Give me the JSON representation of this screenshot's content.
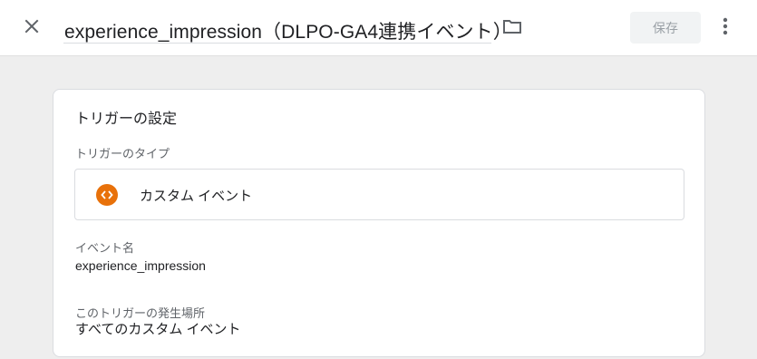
{
  "header": {
    "title": "experience_impression（DLPO-GA4連携イベント）",
    "save_label": "保存",
    "close_icon": "close-icon",
    "folder_icon": "folder-icon",
    "more_icon": "more-vert-icon"
  },
  "trigger": {
    "section_title": "トリガーの設定",
    "type_label": "トリガーのタイプ",
    "type_value": "カスタム イベント",
    "type_icon": "custom-event-icon",
    "type_icon_color": "#e8710a",
    "event_name_label": "イベント名",
    "event_name_value": "experience_impression",
    "fires_on_label": "このトリガーの発生場所",
    "fires_on_value": "すべてのカスタム イベント"
  }
}
